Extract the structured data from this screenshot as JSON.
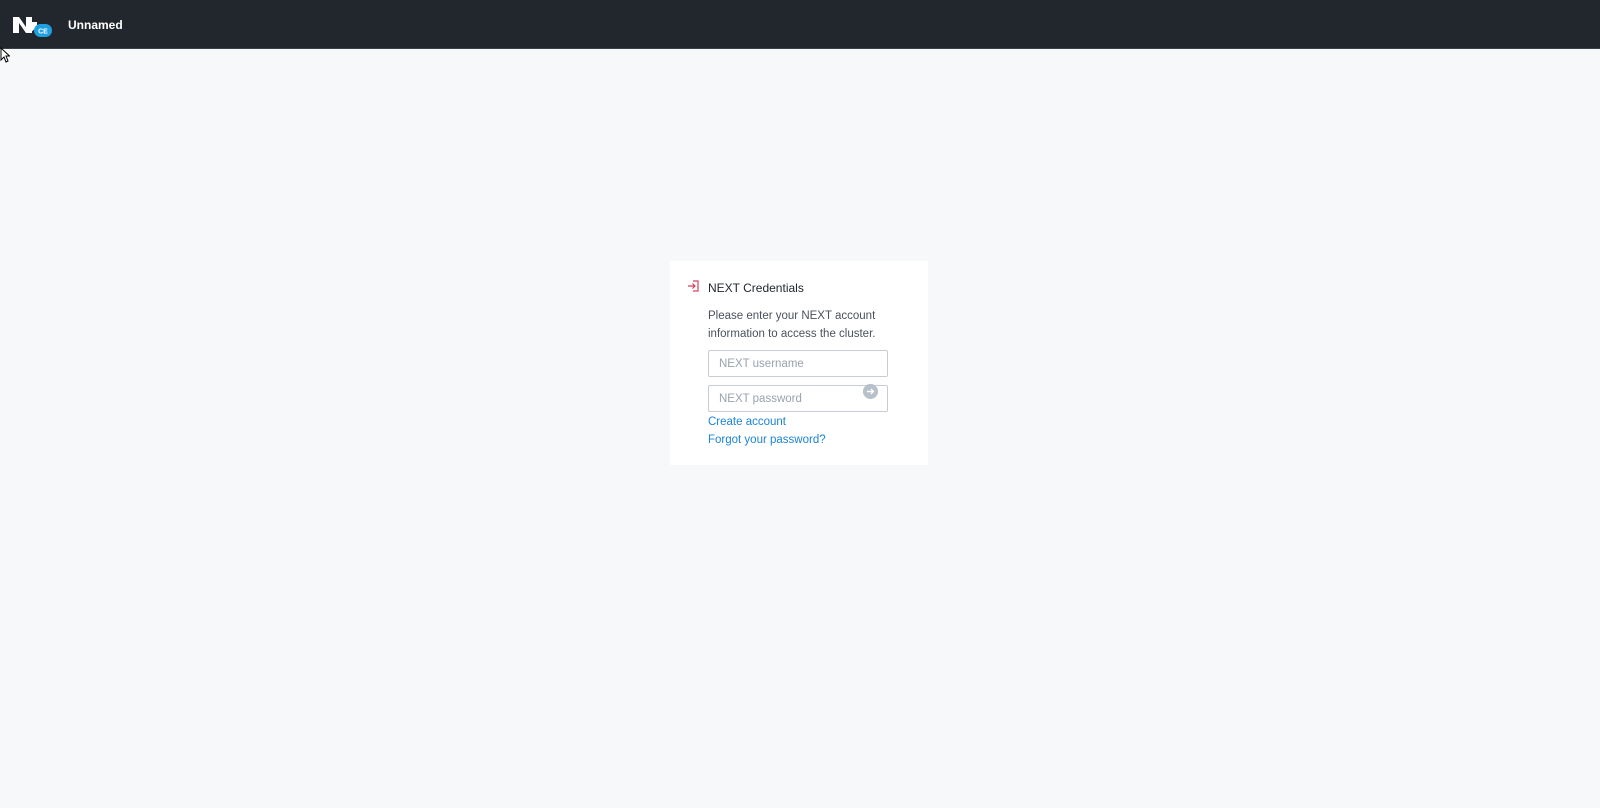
{
  "header": {
    "logo_icon": "nutanix-ce-logo-icon",
    "logo_badge": "CE",
    "cluster_name": "Unnamed",
    "background_color": "#22272e"
  },
  "login_card": {
    "icon": "login-icon",
    "icon_color": "#d6405b",
    "title": "NEXT Credentials",
    "description": "Please enter your NEXT account information to access the cluster.",
    "username": {
      "placeholder": "NEXT username",
      "value": ""
    },
    "password": {
      "placeholder": "NEXT password",
      "value": ""
    },
    "submit_icon": "arrow-right-circle-icon",
    "links": {
      "create_account": "Create account",
      "forgot_password": "Forgot your password?"
    },
    "link_color": "#1b84d6"
  }
}
